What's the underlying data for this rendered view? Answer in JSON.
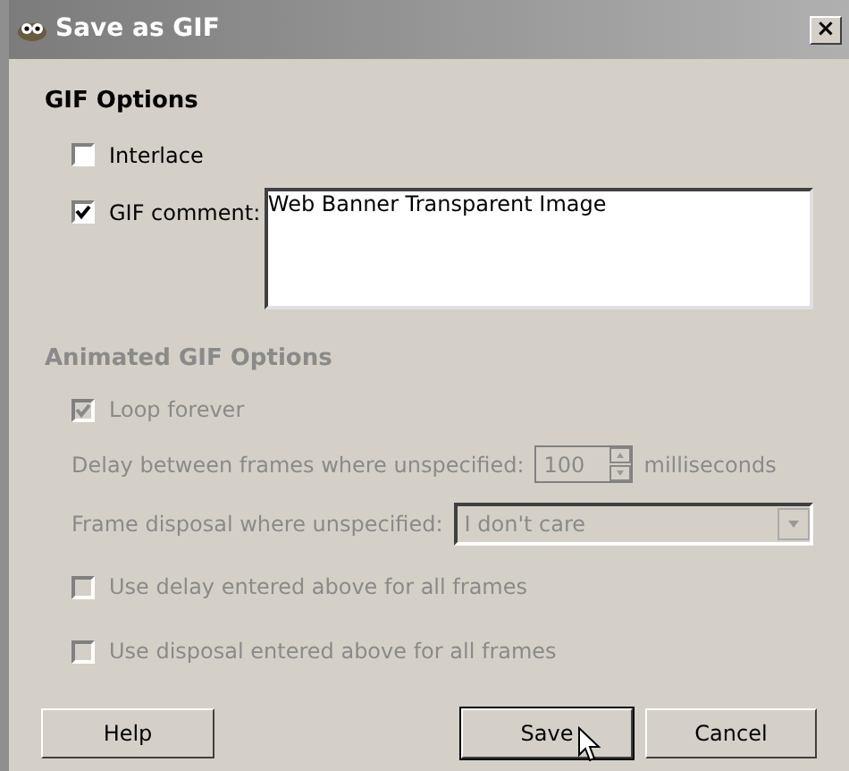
{
  "window": {
    "title": "Save as GIF",
    "close": "×"
  },
  "gif_options": {
    "heading": "GIF Options",
    "interlace": {
      "label": "Interlace",
      "checked": false,
      "disabled": false
    },
    "comment": {
      "label": "GIF comment:",
      "checked": true,
      "disabled": false,
      "value": "Web Banner Transparent Image"
    }
  },
  "animated_options": {
    "heading": "Animated GIF Options",
    "disabled": true,
    "loop": {
      "label": "Loop forever",
      "checked": true
    },
    "delay": {
      "label": "Delay between frames where unspecified:",
      "value": "100",
      "unit": "milliseconds"
    },
    "disposal": {
      "label": "Frame disposal where unspecified:",
      "value": "I don't care"
    },
    "use_delay": {
      "label": "Use delay entered above for all frames",
      "checked": false
    },
    "use_disposal": {
      "label": "Use disposal entered above for all frames",
      "checked": false
    }
  },
  "buttons": [
    {
      "label": "Help",
      "selected": false
    },
    {
      "label": "Save",
      "selected": true
    },
    {
      "label": "Cancel",
      "selected": false
    }
  ]
}
